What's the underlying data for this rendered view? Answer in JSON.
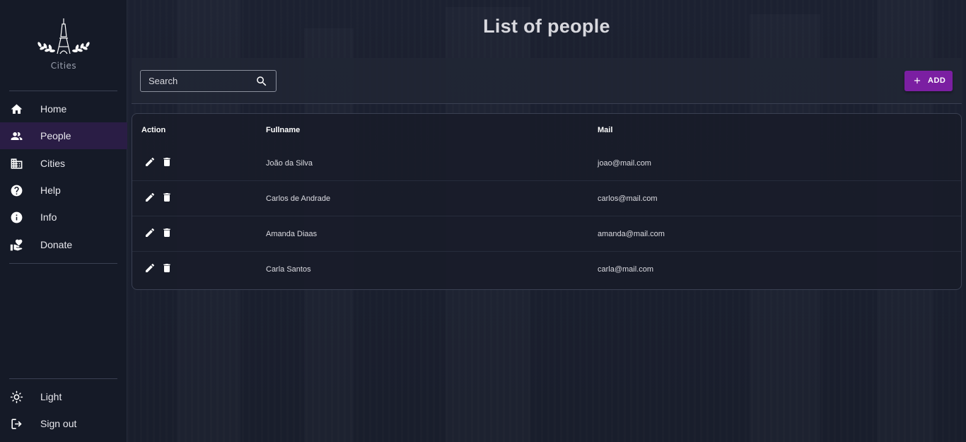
{
  "sidebar": {
    "logo_text": "Cities",
    "nav": [
      {
        "label": "Home",
        "icon": "home-icon"
      },
      {
        "label": "People",
        "icon": "people-icon",
        "active": true
      },
      {
        "label": "Cities",
        "icon": "city-icon"
      },
      {
        "label": "Help",
        "icon": "help-icon"
      },
      {
        "label": "Info",
        "icon": "info-icon"
      },
      {
        "label": "Donate",
        "icon": "donate-icon"
      }
    ],
    "bottom": [
      {
        "label": "Light",
        "icon": "sun-icon"
      },
      {
        "label": "Sign out",
        "icon": "logout-icon"
      }
    ]
  },
  "page": {
    "title": "List of people",
    "search_placeholder": "Search",
    "add_label": "ADD",
    "accent_color": "#7b1fa2"
  },
  "table": {
    "headers": {
      "action": "Action",
      "fullname": "Fullname",
      "mail": "Mail"
    },
    "rows": [
      {
        "fullname": "João da Silva",
        "mail": "joao@mail.com"
      },
      {
        "fullname": "Carlos de Andrade",
        "mail": "carlos@mail.com"
      },
      {
        "fullname": "Amanda Diaas",
        "mail": "amanda@mail.com"
      },
      {
        "fullname": "Carla Santos",
        "mail": "carla@mail.com"
      }
    ]
  }
}
